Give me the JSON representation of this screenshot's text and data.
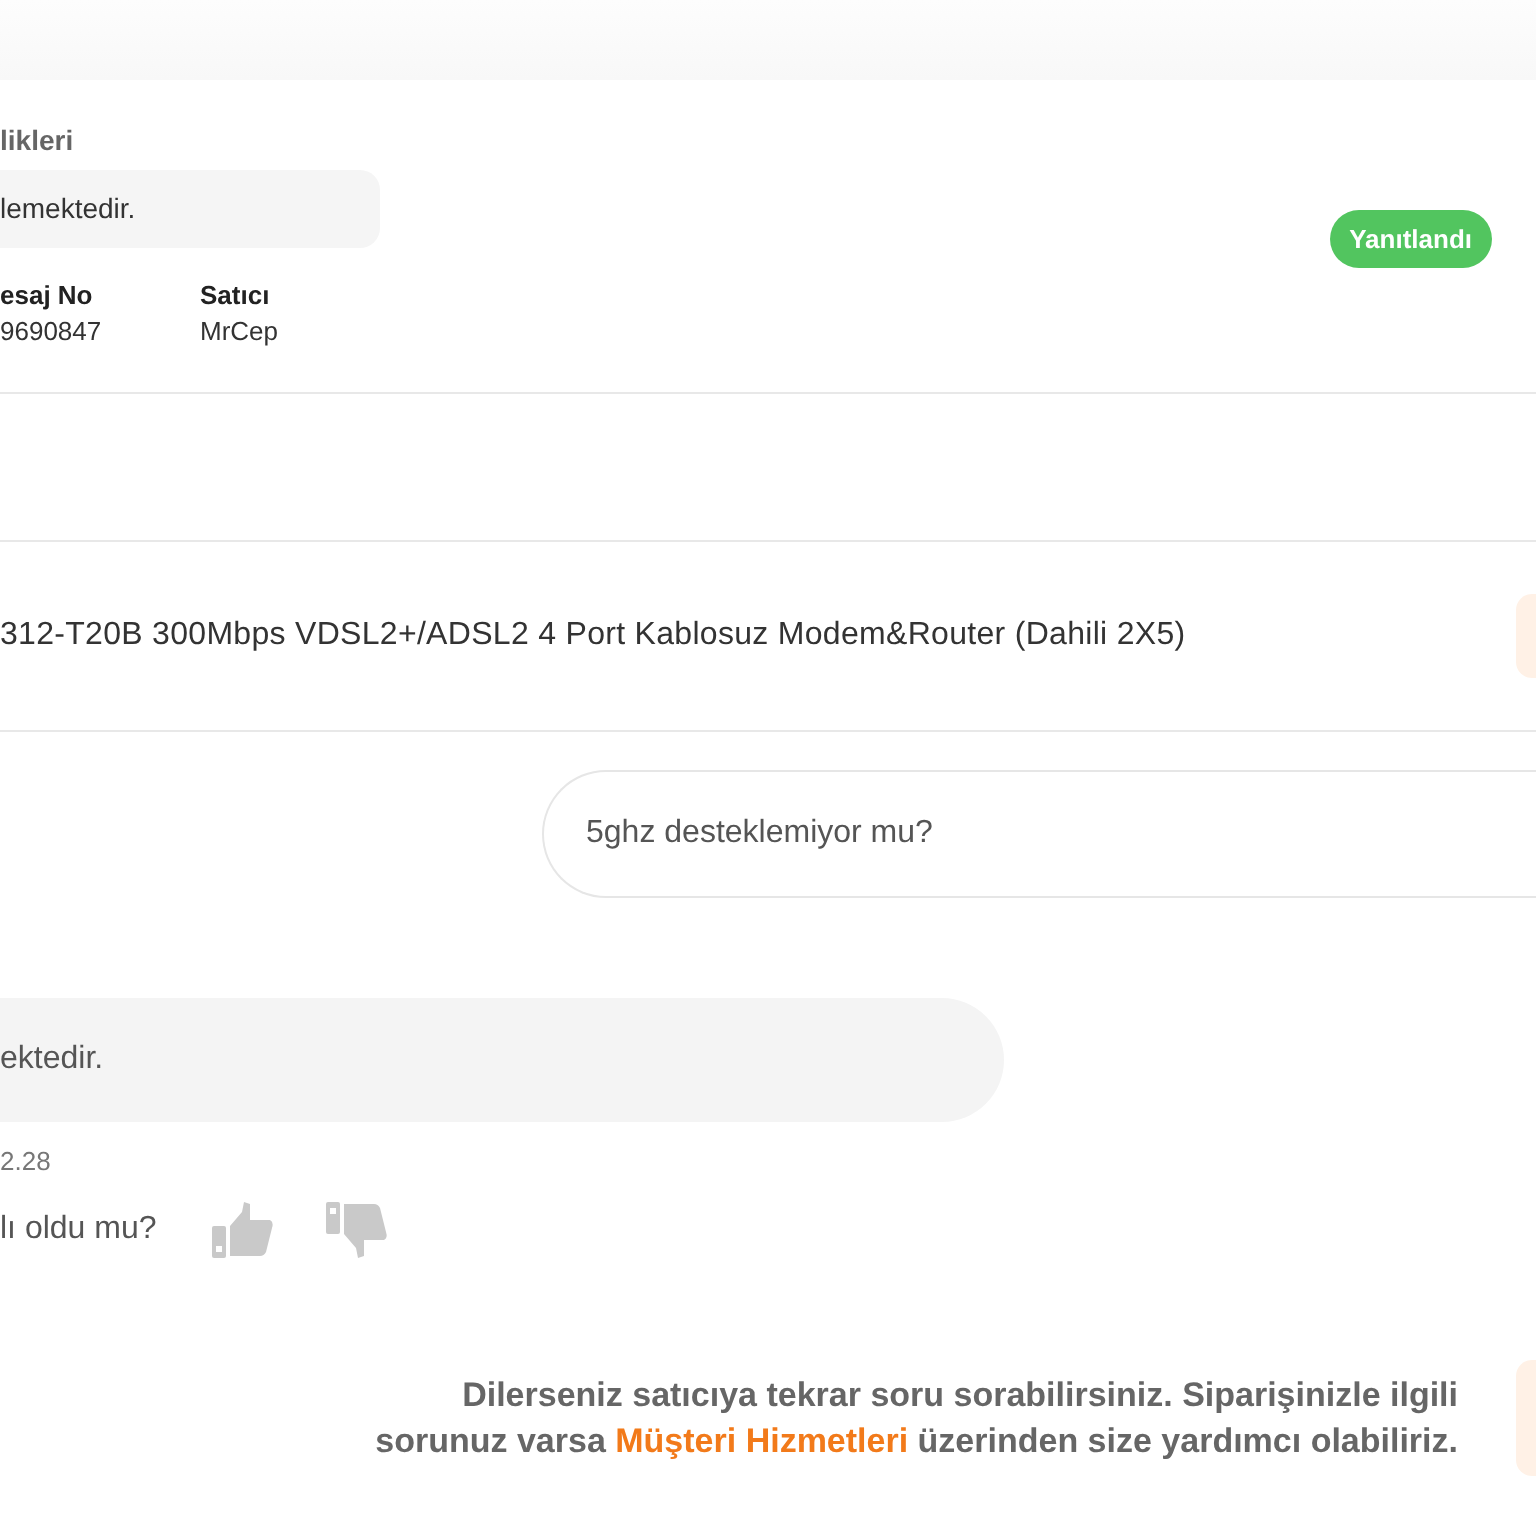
{
  "question_card": {
    "title": "likleri",
    "snippet": "lemektedir.",
    "status": {
      "label": "Yanıtlandı",
      "color": "#52c55f"
    },
    "details": [
      {
        "label": "esaj No",
        "value": "9690847"
      },
      {
        "label": "Satıcı",
        "value": "MrCep"
      }
    ]
  },
  "product": {
    "name": "312-T20B 300Mbps VDSL2+/ADSL2 4 Port Kablosuz Modem&Router (Dahili 2X5)"
  },
  "messages": [
    {
      "kind": "question",
      "text": "5ghz desteklemiyor mu?"
    },
    {
      "kind": "answer",
      "text": "ektedir.",
      "time": "2.28"
    }
  ],
  "feedback": {
    "prompt": "lı oldu mu?"
  },
  "footer": {
    "line_1": "Dilerseniz satıcıya tekrar soru sorabilirsiniz. Siparişinizle ilgili",
    "line_2_start": "sorunuz varsa",
    "link": "Müşteri Hizmetleri",
    "line_2_end": "üzerinden size yardımcı olabiliriz."
  }
}
